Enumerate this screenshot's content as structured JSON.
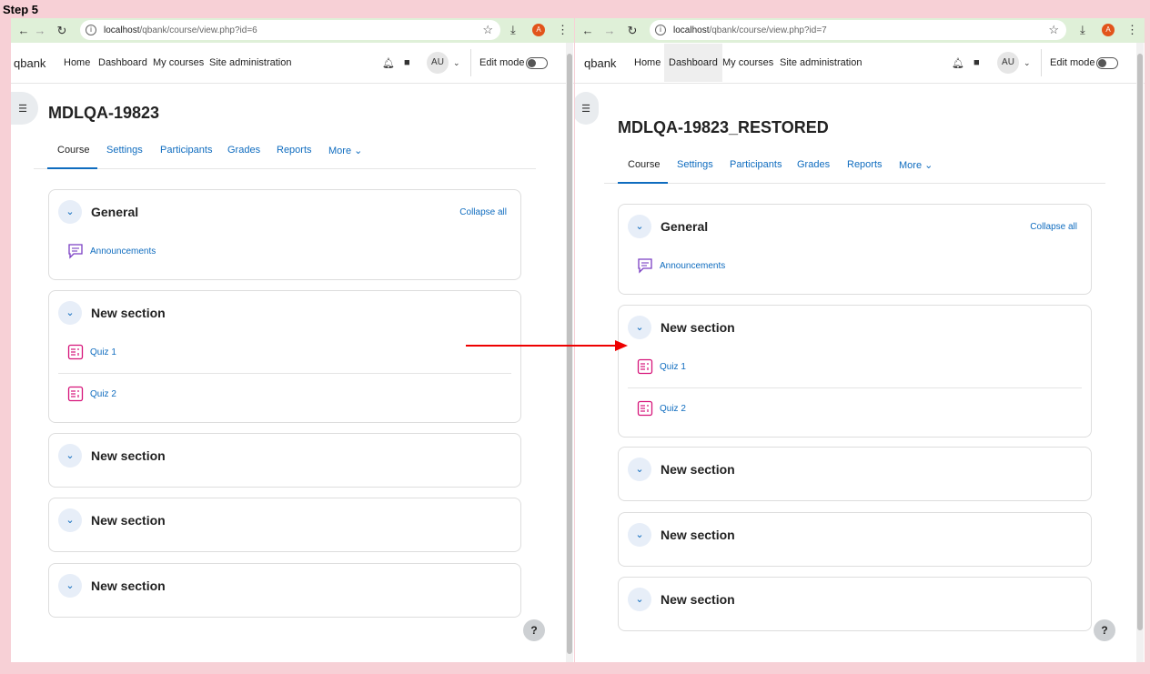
{
  "step_label": "Step 5",
  "panes": {
    "left": {
      "url_host": "localhost",
      "url_path": "/qbank/course/view.php?id=6",
      "brand": "qbank",
      "nav": [
        "Home",
        "Dashboard",
        "My courses",
        "Site administration"
      ],
      "avatar": "AU",
      "edit_mode": "Edit mode",
      "course_title": "MDLQA-19823",
      "tabs": [
        "Course",
        "Settings",
        "Participants",
        "Grades",
        "Reports",
        "More"
      ],
      "collapse_all": "Collapse all",
      "sections": [
        {
          "title": "General",
          "activities": [
            "Announcements"
          ]
        },
        {
          "title": "New section",
          "activities": [
            "Quiz 1",
            "Quiz 2"
          ]
        },
        {
          "title": "New section",
          "activities": []
        },
        {
          "title": "New section",
          "activities": []
        },
        {
          "title": "New section",
          "activities": []
        }
      ],
      "help": "?"
    },
    "right": {
      "url_host": "localhost",
      "url_path": "/qbank/course/view.php?id=7",
      "brand": "qbank",
      "nav": [
        "Home",
        "Dashboard",
        "My courses",
        "Site administration"
      ],
      "avatar": "AU",
      "edit_mode": "Edit mode",
      "course_title": "MDLQA-19823_RESTORED",
      "tabs": [
        "Course",
        "Settings",
        "Participants",
        "Grades",
        "Reports",
        "More"
      ],
      "collapse_all": "Collapse all",
      "sections": [
        {
          "title": "General",
          "activities": [
            "Announcements"
          ]
        },
        {
          "title": "New section",
          "activities": [
            "Quiz 1",
            "Quiz 2"
          ]
        },
        {
          "title": "New section",
          "activities": []
        },
        {
          "title": "New section",
          "activities": []
        },
        {
          "title": "New section",
          "activities": []
        }
      ],
      "help": "?"
    }
  },
  "profile_initial": "A",
  "colors": {
    "link": "#0f6cbf",
    "arrow": "#ee0000",
    "chrome": "#dff0d8",
    "background": "#f7d0d6"
  },
  "icons": [
    "back-icon",
    "forward-icon",
    "reload-icon",
    "info-icon",
    "star-icon",
    "download-icon",
    "kebab-icon",
    "bell-icon",
    "chat-icon",
    "chevron-down-icon",
    "forum-icon",
    "quiz-icon",
    "drawer-icon",
    "help-icon"
  ]
}
